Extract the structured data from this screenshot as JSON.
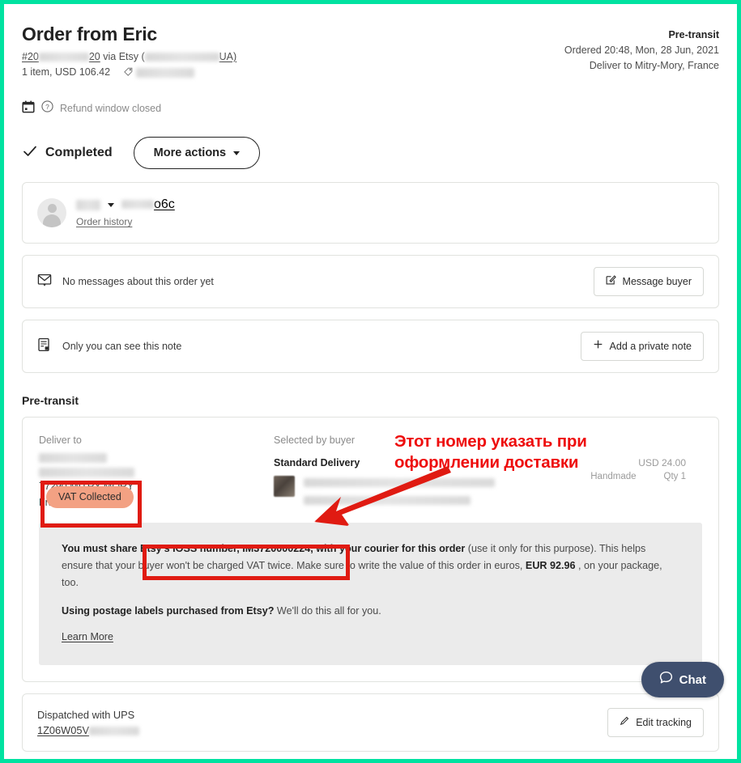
{
  "header": {
    "title": "Order from Eric",
    "order_prefix": "#20",
    "order_suffix": "20",
    "via_text": "via Etsy (",
    "shop_suffix": "UA)",
    "items_price": "1 item,  USD 106.42",
    "status": "Pre-transit",
    "ordered": "Ordered 20:48, Mon, 28 Jun, 2021",
    "deliver_to": "Deliver to Mitry-Mory, France",
    "refund_text": "Refund window closed",
    "calendar_icon": "calendar-icon",
    "help_icon": "question-circle-icon",
    "tag_icon": "tag-icon"
  },
  "status_row": {
    "completed_label": "Completed",
    "check_icon": "check-icon",
    "more_actions_label": "More actions",
    "caret_icon": "chevron-down-icon"
  },
  "buyer": {
    "avatar_icon": "avatar-icon",
    "caret_icon": "chevron-down-icon",
    "username_suffix": "o6c",
    "order_history_label": "Order history"
  },
  "messages": {
    "icon": "envelope-icon",
    "text": "No messages about this order yet",
    "button_label": "Message buyer",
    "button_icon": "compose-icon"
  },
  "note": {
    "icon": "private-note-icon",
    "text": "Only you can see this note",
    "button_label": "Add a private note",
    "button_icon": "plus-icon"
  },
  "shipment": {
    "section_title": "Pre-transit",
    "deliver_to_label": "Deliver to",
    "address_city": "77290 MITRY-MORY",
    "address_country": "France",
    "selected_by_buyer_label": "Selected by buyer",
    "service": "Standard Delivery",
    "price": "USD 24.00",
    "handmade": "Handmade",
    "qty": "Qty 1",
    "vat_badge": "VAT Collected",
    "thumb_icon": "product-thumbnail"
  },
  "notice": {
    "lead_bold_a": "You must share ",
    "ioss_bold": "Etsy's IOSS number, IM3720000224,",
    "lead_bold_b": " with your courier for this order",
    "lead_rest": " (use it only for this purpose). This helps ensure that your buyer won't be charged VAT twice. Make sure to write the value of this order in euros, ",
    "eur_amount": "EUR 92.96",
    "tail": " , on your package, too.",
    "postage_bold": "Using postage labels purchased from Etsy?",
    "postage_rest": " We'll do this all for you.",
    "learn_more": "Learn More"
  },
  "dispatch": {
    "line1": "Dispatched with UPS",
    "tracking_prefix": "1Z06W05V",
    "edit_label": "Edit tracking",
    "edit_icon": "pencil-icon"
  },
  "annotation": {
    "line1": "Этот номер указать при",
    "line2": "оформлении доставки",
    "arrow_icon": "red-arrow-icon",
    "color": "#ee0d0d"
  },
  "chat": {
    "label": "Chat",
    "icon": "chat-bubble-icon",
    "color": "#3f4f6e"
  },
  "theme": {
    "border": "#00e2a0",
    "vat_pill": "#f3a183",
    "highlight_box": "#e01b12"
  }
}
